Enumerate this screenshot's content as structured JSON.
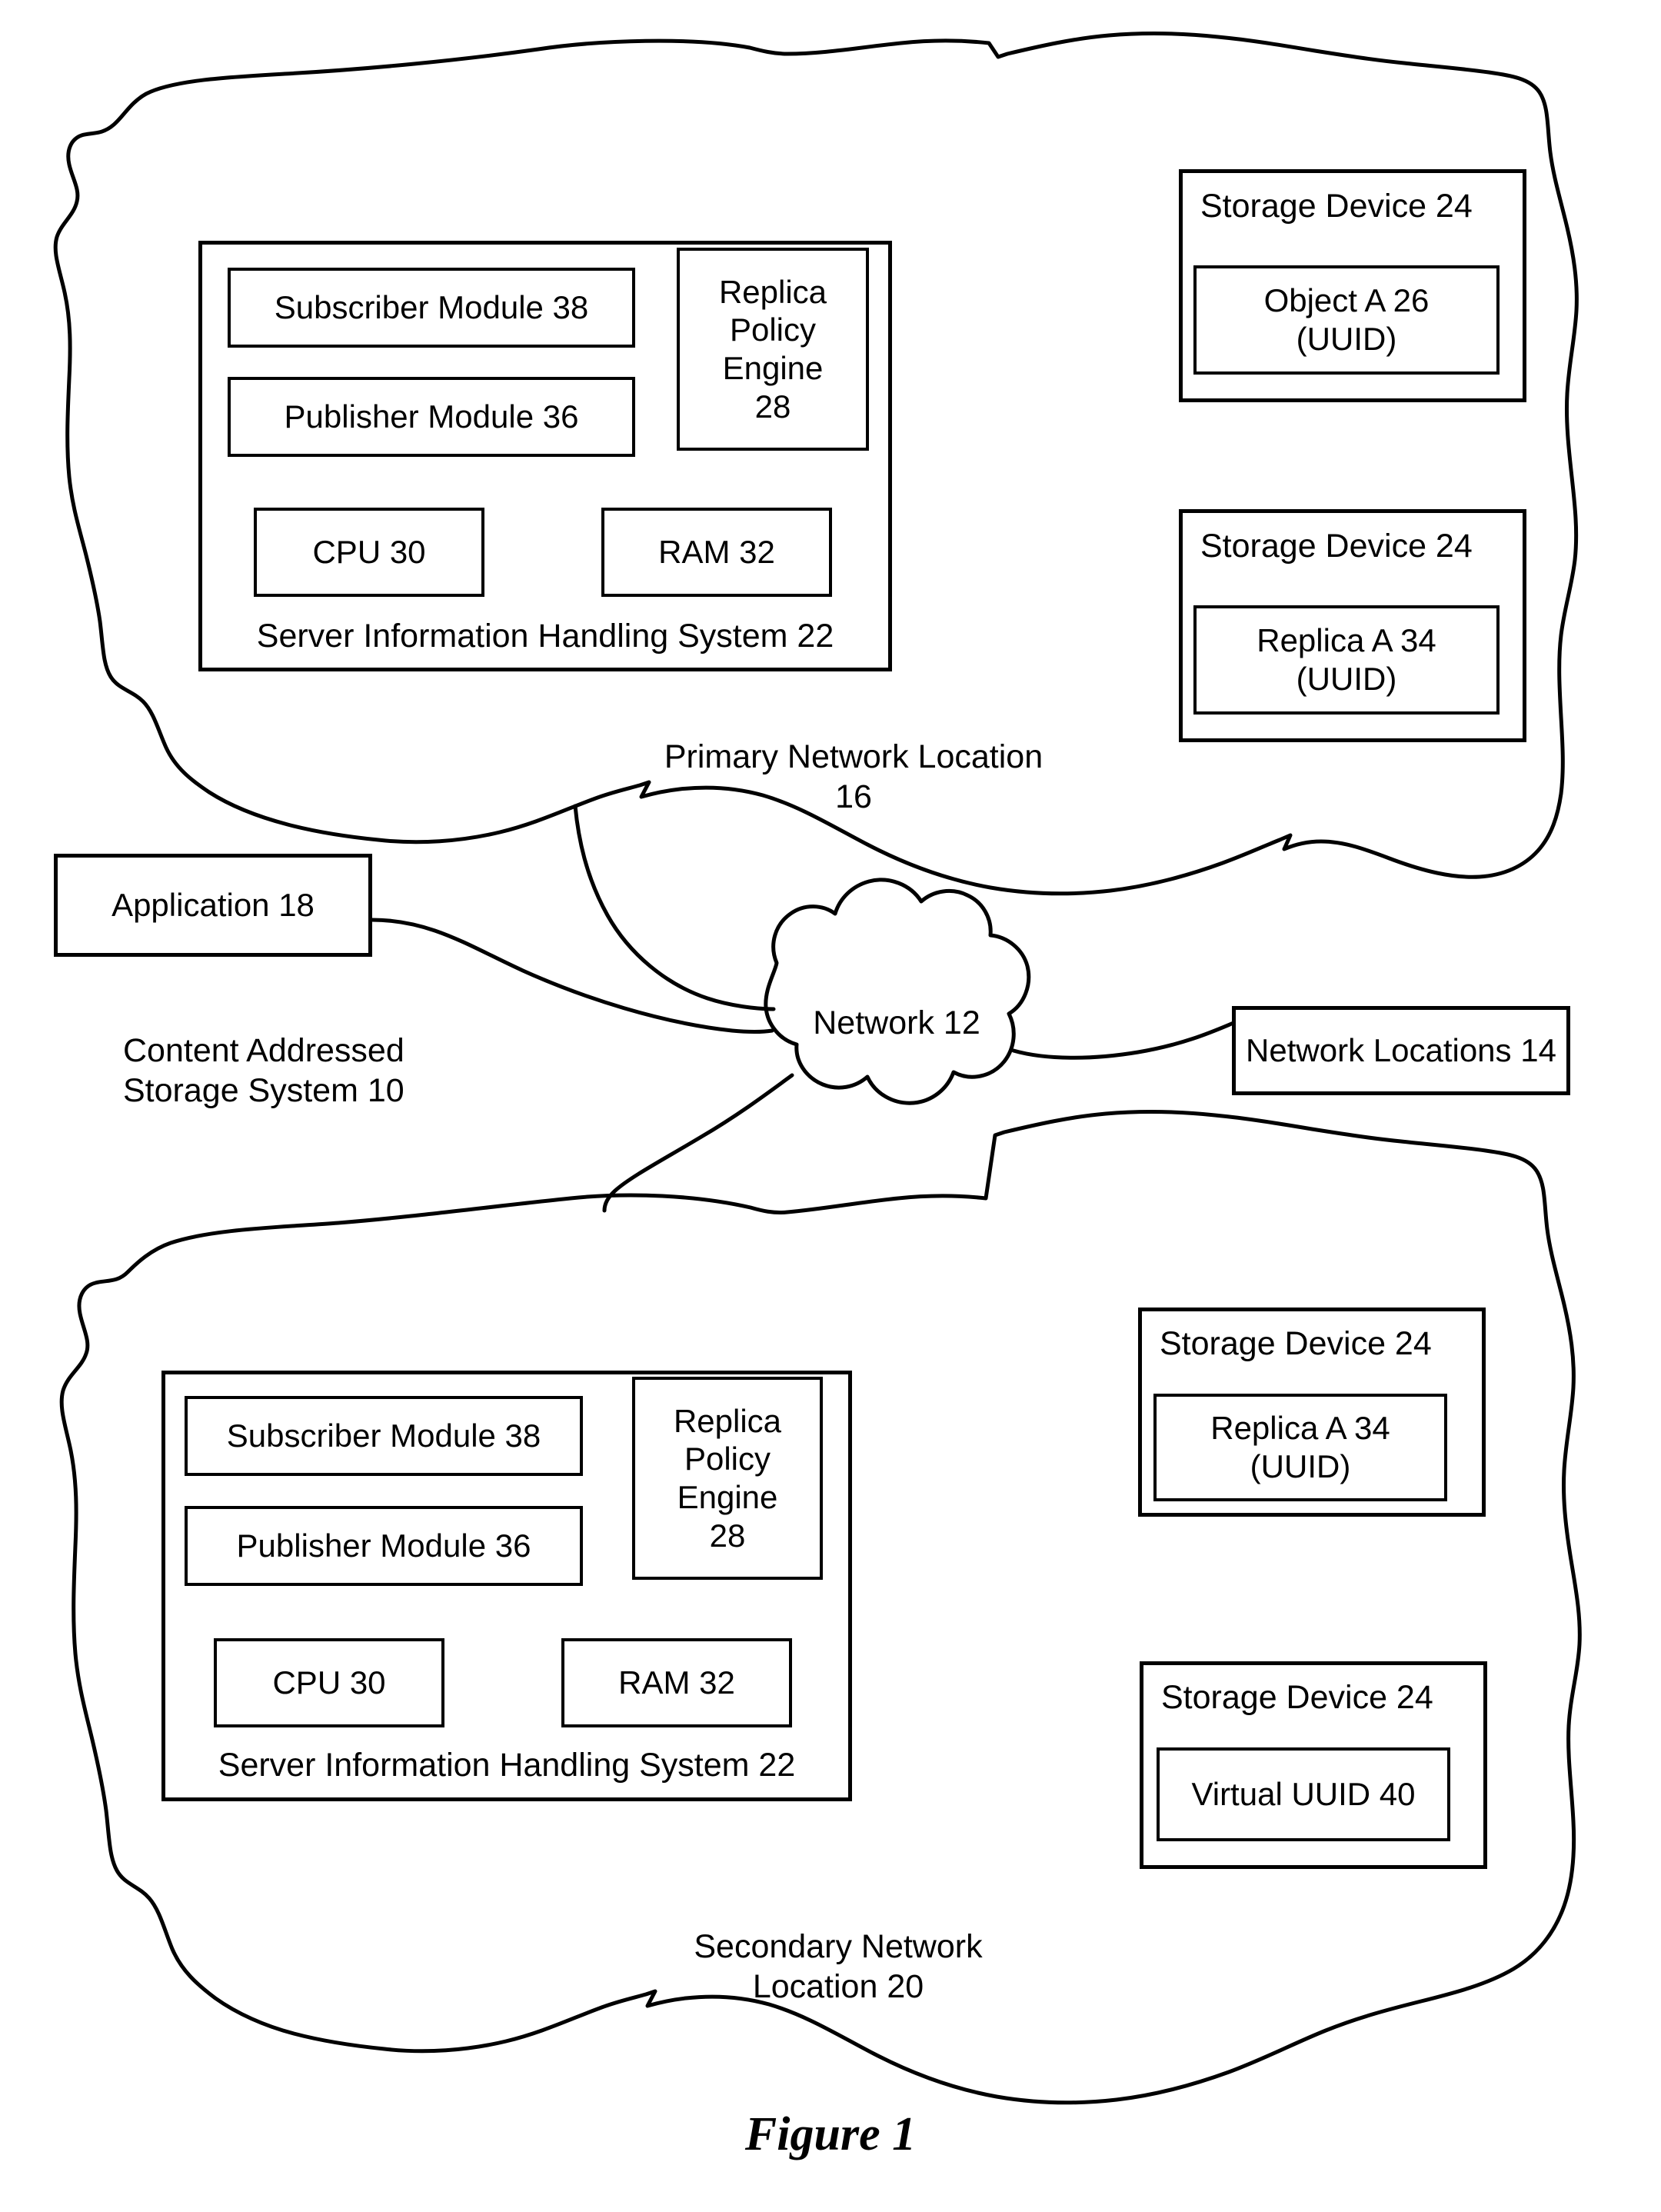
{
  "figure": {
    "caption": "Figure 1",
    "system_label": "Content Addressed\nStorage System 10"
  },
  "network": {
    "cloud_label": "Network 12",
    "network_locations_label": "Network Locations 14",
    "application_label": "Application 18"
  },
  "primary": {
    "region_label": "Primary Network Location\n16",
    "server": {
      "title": "Server Information Handling System 22",
      "subscriber_module": "Subscriber Module 38",
      "publisher_module": "Publisher Module 36",
      "replica_policy_engine": "Replica\nPolicy\nEngine\n28",
      "cpu": "CPU 30",
      "ram": "RAM 32"
    },
    "storage_devices": [
      {
        "title": "Storage Device 24",
        "content": "Object A 26\n(UUID)"
      },
      {
        "title": "Storage Device 24",
        "content": "Replica A 34\n(UUID)"
      }
    ]
  },
  "secondary": {
    "region_label": "Secondary Network\nLocation 20",
    "server": {
      "title": "Server Information Handling System 22",
      "subscriber_module": "Subscriber Module 38",
      "publisher_module": "Publisher Module 36",
      "replica_policy_engine": "Replica\nPolicy\nEngine\n28",
      "cpu": "CPU 30",
      "ram": "RAM 32"
    },
    "storage_devices": [
      {
        "title": "Storage Device 24",
        "content": "Replica A 34\n(UUID)"
      },
      {
        "title": "Storage Device 24",
        "content": "Virtual UUID 40"
      }
    ]
  },
  "colors": {
    "stroke": "#000000",
    "background": "#ffffff"
  }
}
